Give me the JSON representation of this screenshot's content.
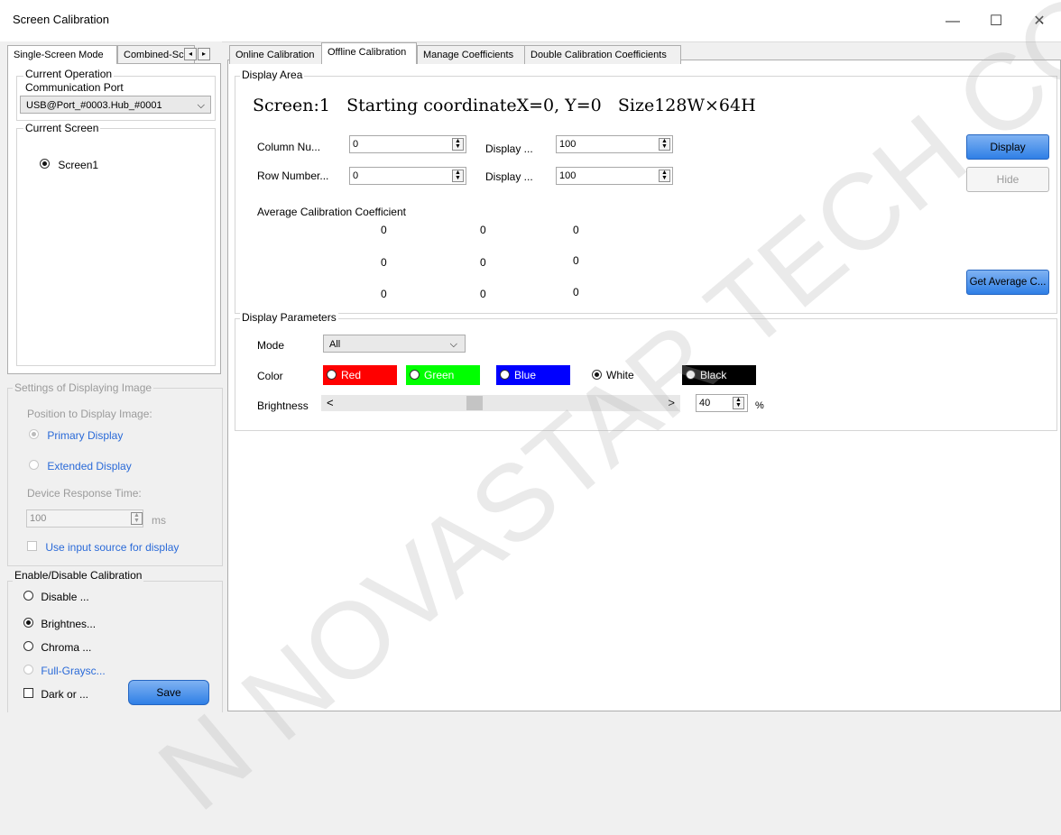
{
  "window": {
    "title": "Screen Calibration",
    "minimize_glyph": "—",
    "maximize_glyph": "☐",
    "close_glyph": "✕"
  },
  "left_tabs": [
    "Single-Screen Mode",
    "Combined-Sc"
  ],
  "left": {
    "current_operation_label": "Current Operation",
    "comm_port_label": "Communication Port",
    "comm_port_value": "USB@Port_#0003.Hub_#0001",
    "current_screen_label": "Current Screen",
    "screen_item": "Screen1",
    "settings_label": "Settings of Displaying Image",
    "position_label": "Position to Display Image:",
    "primary_display": "Primary Display",
    "extended_display": "Extended Display",
    "response_time_label": "Device Response Time:",
    "response_time_value": "100",
    "response_unit": "ms",
    "use_input_source": "Use input source for display",
    "enable_disable_label": "Enable/Disable Calibration",
    "options": [
      "Disable ...",
      "Brightnes...",
      "Chroma ...",
      "Full-Graysc..."
    ],
    "dark_or": "Dark or ...",
    "save_button": "Save"
  },
  "main_tabs": [
    "Online Calibration",
    "Offline Calibration",
    "Manage Coefficients",
    "Double Calibration Coefficients"
  ],
  "display_area": {
    "label": "Display Area",
    "screen_info": "Screen:1   Starting coordinateX=0, Y=0   Size128W×64H",
    "column_label": "Column Nu...",
    "column_value": "0",
    "row_label": "Row Number...",
    "row_value": "0",
    "display_label_1": "Display ...",
    "display_value_1": "100",
    "display_label_2": "Display ...",
    "display_value_2": "100",
    "display_button": "Display",
    "hide_button": "Hide",
    "avg_label": "Average Calibration Coefficient",
    "avg_matrix": [
      [
        "0",
        "0",
        "0"
      ],
      [
        "0",
        "0",
        "0"
      ],
      [
        "0",
        "0",
        "0"
      ]
    ],
    "get_average_button": "Get Average C..."
  },
  "display_params": {
    "label": "Display Parameters",
    "mode_label": "Mode",
    "mode_value": "All",
    "color_label": "Color",
    "colors": [
      {
        "name": "Red",
        "bg": "#ff0000",
        "fg": "#ffffff"
      },
      {
        "name": "Green",
        "bg": "#00ff00",
        "fg": "#ffffff"
      },
      {
        "name": "Blue",
        "bg": "#0000ff",
        "fg": "#ffffff"
      },
      {
        "name": "White",
        "bg": "#ffffff",
        "fg": "#000000"
      },
      {
        "name": "Black",
        "bg": "#000000",
        "fg": "#ffffff"
      }
    ],
    "selected_color": "White",
    "brightness_label": "Brightness",
    "brightness_value": "40",
    "brightness_unit": "%"
  },
  "watermark": "N NOVASTAR TECH CO., LTD"
}
